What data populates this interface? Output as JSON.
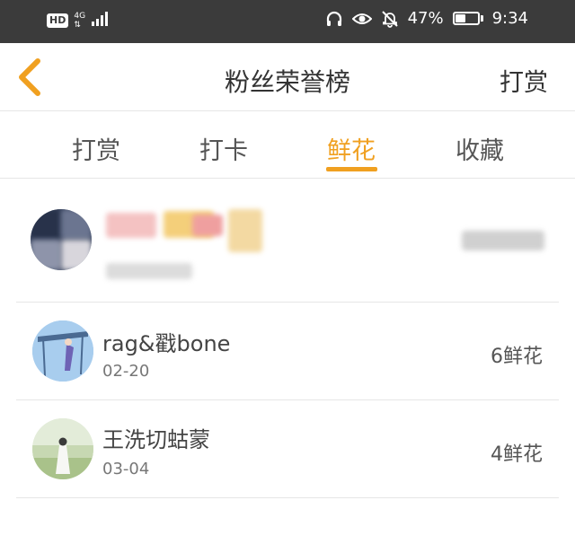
{
  "status_bar": {
    "hd_label": "HD",
    "network_top": "4G",
    "network_bottom": "⇅",
    "battery_percent": "47%",
    "battery_level": 0.47,
    "time": "9:34"
  },
  "nav": {
    "title": "粉丝荣誉榜",
    "action_label": "打赏"
  },
  "tabs": [
    {
      "label": "打赏",
      "active": false
    },
    {
      "label": "打卡",
      "active": false
    },
    {
      "label": "鲜花",
      "active": true
    },
    {
      "label": "收藏",
      "active": false
    }
  ],
  "list": [
    {
      "name": "rag&戳bone",
      "date": "02-20",
      "value": "6鲜花"
    },
    {
      "name": "王洗切蛄蒙",
      "date": "03-04",
      "value": "4鲜花"
    }
  ],
  "colors": {
    "accent": "#f0a020",
    "status_bar_bg": "#3b3b3b"
  }
}
